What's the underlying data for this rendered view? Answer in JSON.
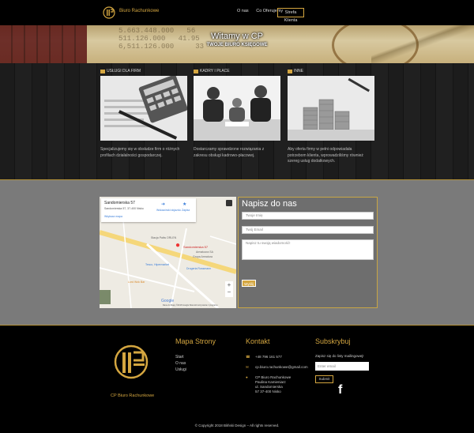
{
  "nav": {
    "brand": "Biuro Rachunkowe",
    "links": [
      "O nas",
      "Co Oferujemy"
    ],
    "client_button": "Strefa Klienta"
  },
  "hero": {
    "title": "Witamy w CP",
    "subtitle": "TWOJE BIURO KSIĘGOWE",
    "numbers": "5.663.448.000   56\n511.126.000   41.95\n6,511.126.000     33"
  },
  "services": [
    {
      "title": "USŁUGI DLA FIRM",
      "text": "Specjalizujemy się w obsłudze firm o różnych profilach działalności gospodarczej."
    },
    {
      "title": "KADRY I PŁACE",
      "text": "Dostarczamy sprawdzone rozwiązania z zakresu obsługi kadrowo-płacowej."
    },
    {
      "title": "INNE",
      "text": "Aby oferta firmy w pełni odpowiadała potrzebom klienta, wprowadziliśmy również szereg usług dodatkowych."
    }
  ],
  "map": {
    "place": "Sandomierska 57",
    "address": "Sandomierska 57, 37-400 Nisko",
    "link": "Większa mapa",
    "directions": "Wskazówki dojazdu",
    "save": "Zapisz",
    "marker_label": "Sandomierska 57",
    "pois": [
      "Stacja Paliw ORLEN",
      "Armatoora SA",
      "Grupa Armatura",
      "Tesco, Hipermarket",
      "Drogeria Rossmann",
      "Lord Wok Bar"
    ],
    "footer_text": "Dane do Mapy ©2018 Google   Warunki korzystania z programu",
    "google": "Google"
  },
  "form": {
    "title": "Napisz do nas",
    "name_placeholder": "Twoje Imię",
    "email_placeholder": "Twój Email",
    "message_placeholder": "Napisz tu swoją wiadomość!",
    "send": "Wyślij"
  },
  "footer": {
    "brand": "CP Biuro Rachunkowe",
    "sitemap_title": "Mapa Strony",
    "sitemap_links": [
      "Start",
      "O nas",
      "Usługi"
    ],
    "contact_title": "Kontakt",
    "phone": "+48 796 161 577",
    "email": "cp.biuro.rachunkowe@gmail.com",
    "address_lines": [
      "CP Biuro Rachunkowe",
      "Paulina Kamieniarz",
      "ul. Sandomierska",
      "57 37-400 Nisko"
    ],
    "subscribe_title": "Subskrybuj",
    "subscribe_text": "Zapisz się do listy mailingowej!",
    "email_placeholder": "Enter email",
    "subscribe_button": "Submit",
    "facebook": "f",
    "copyright": "© Copyright 2018 Bilński Design – All rights reserved."
  }
}
